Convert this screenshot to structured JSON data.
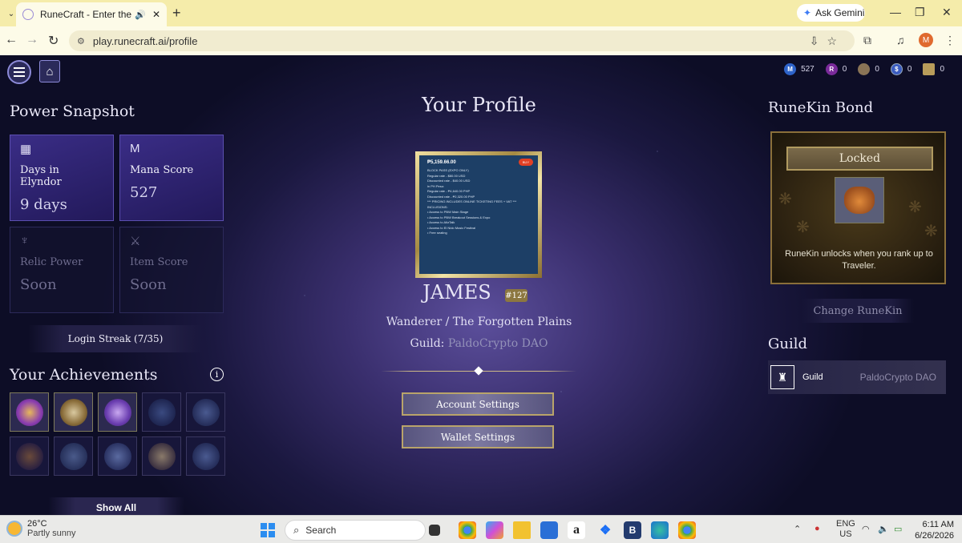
{
  "browser": {
    "tab_title": "RuneCraft - Enter the Mystic",
    "url": "play.runecraft.ai/profile",
    "ask_gemini": "Ask Gemini",
    "profile_initial": "M",
    "accent": "#f5ecaa"
  },
  "header": {
    "currencies": [
      {
        "icon": "mana-coin-icon",
        "symbol": "M",
        "value": "527",
        "color": "#2e63c9"
      },
      {
        "icon": "rune-coin-icon",
        "symbol": "R",
        "value": "0",
        "color": "#7a2a9a"
      },
      {
        "icon": "bronze-coin-icon",
        "symbol": "",
        "value": "0",
        "color": "#8a7456"
      },
      {
        "icon": "dollar-coin-icon",
        "symbol": "$",
        "value": "0",
        "color": "#3b5cc0"
      },
      {
        "icon": "scroll-icon",
        "symbol": "",
        "value": "0",
        "color": "#b89c5a"
      }
    ]
  },
  "left": {
    "power_title": "Power Snapshot",
    "stats": [
      {
        "label": "Days in Elyndor",
        "value": "9 days",
        "icon": "calendar-icon"
      },
      {
        "label": "Mana Score",
        "value": "527",
        "icon": "mana-rune-icon"
      },
      {
        "label": "Relic Power",
        "value": "Soon",
        "icon": "relic-icon"
      },
      {
        "label": "Item Score",
        "value": "Soon",
        "icon": "crossed-swords-icon"
      }
    ],
    "login_streak": "Login Streak (7/35)",
    "achievements_title": "Your Achievements",
    "info": "i",
    "show_all": "Show All"
  },
  "center": {
    "title": "Your Profile",
    "avatar_card": {
      "price": "₱5,159.66.00",
      "buy": "BUY",
      "lines": [
        "BLOCK PASS (EXPO ONLY)",
        "Regular rate - $80.00 USD",
        "Discounted rate - $40.00 USD",
        "",
        "in PH Peso:",
        "Regular rate - ₱4,640.00 PHP",
        "Discounted rate - ₱2,320.00 PHP",
        "",
        "*** PRICING INCLUDES ONLINE TICKETING FEES + VAT ***",
        "",
        "INCLUSIONS:",
        "",
        "• Access to PBW Main Stage",
        "• Access to PBW Breakout Sessions & Expo",
        "• Access to AltzTalk",
        "• Access to El Nido Music Festival",
        "• Free seating"
      ]
    },
    "name": "JAMES",
    "rank": "#127",
    "class_title": "Wanderer / The Forgotten Plains",
    "guild_label": "Guild: ",
    "guild_name": "PaldoCrypto DAO",
    "account_settings": "Account Settings",
    "wallet_settings": "Wallet Settings"
  },
  "right": {
    "bond_title": "RuneKin Bond",
    "locked": "Locked",
    "bond_message": "RuneKin unlocks when you rank up to Traveler.",
    "change_runekin": "Change RuneKin",
    "guild_title": "Guild",
    "guild_label": "Guild",
    "guild_value": "PaldoCrypto DAO"
  },
  "taskbar": {
    "temp": "26°C",
    "weather": "Partly sunny",
    "search": "Search",
    "lang1": "ENG",
    "lang2": "US",
    "time": "6:11 AM",
    "date": "6/26/2026"
  }
}
